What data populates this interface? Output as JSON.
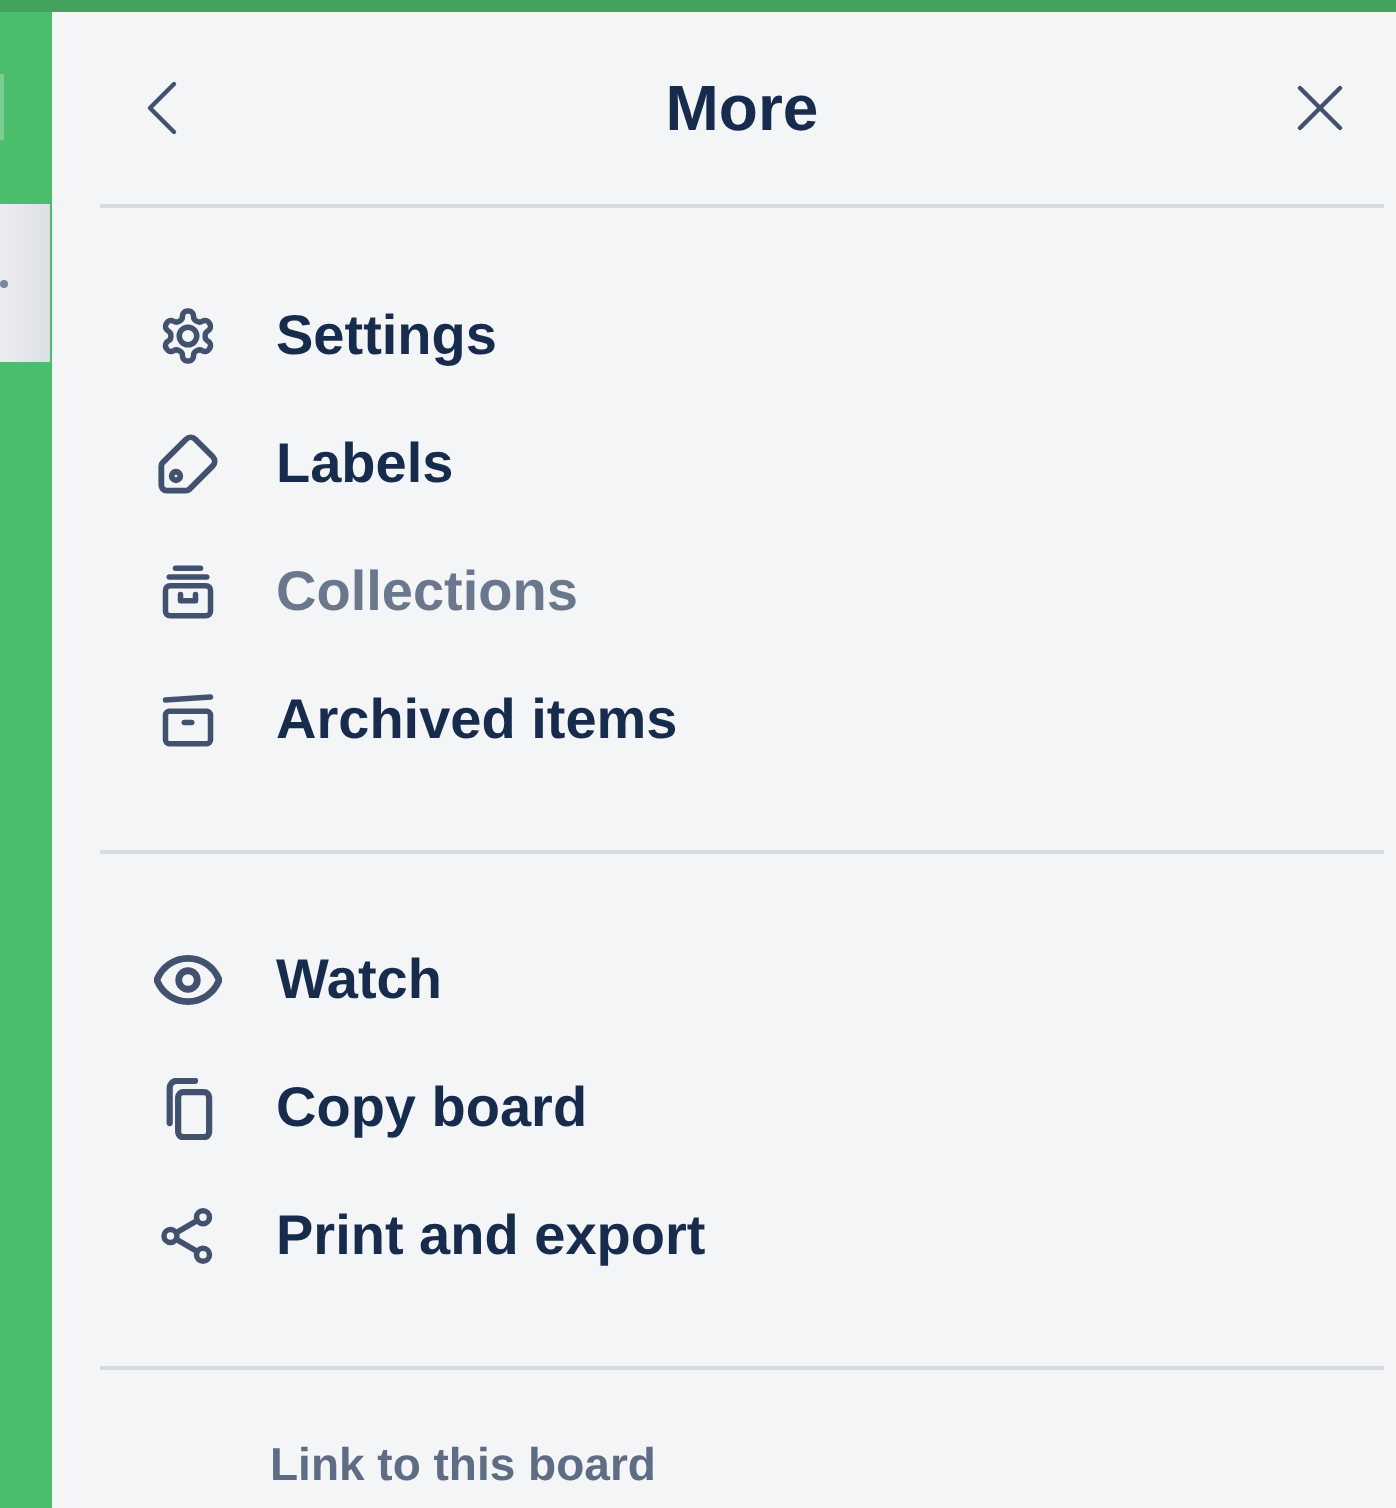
{
  "header": {
    "title": "More"
  },
  "sections": [
    {
      "items": [
        {
          "kind": "settings",
          "label": "Settings",
          "disabled": false
        },
        {
          "kind": "labels",
          "label": "Labels",
          "disabled": false
        },
        {
          "kind": "collections",
          "label": "Collections",
          "disabled": true
        },
        {
          "kind": "archive",
          "label": "Archived items",
          "disabled": false
        }
      ]
    },
    {
      "items": [
        {
          "kind": "watch",
          "label": "Watch",
          "disabled": false
        },
        {
          "kind": "copy",
          "label": "Copy board",
          "disabled": false
        },
        {
          "kind": "export",
          "label": "Print and export",
          "disabled": false
        }
      ]
    }
  ],
  "footer": {
    "heading": "Link to this board"
  }
}
